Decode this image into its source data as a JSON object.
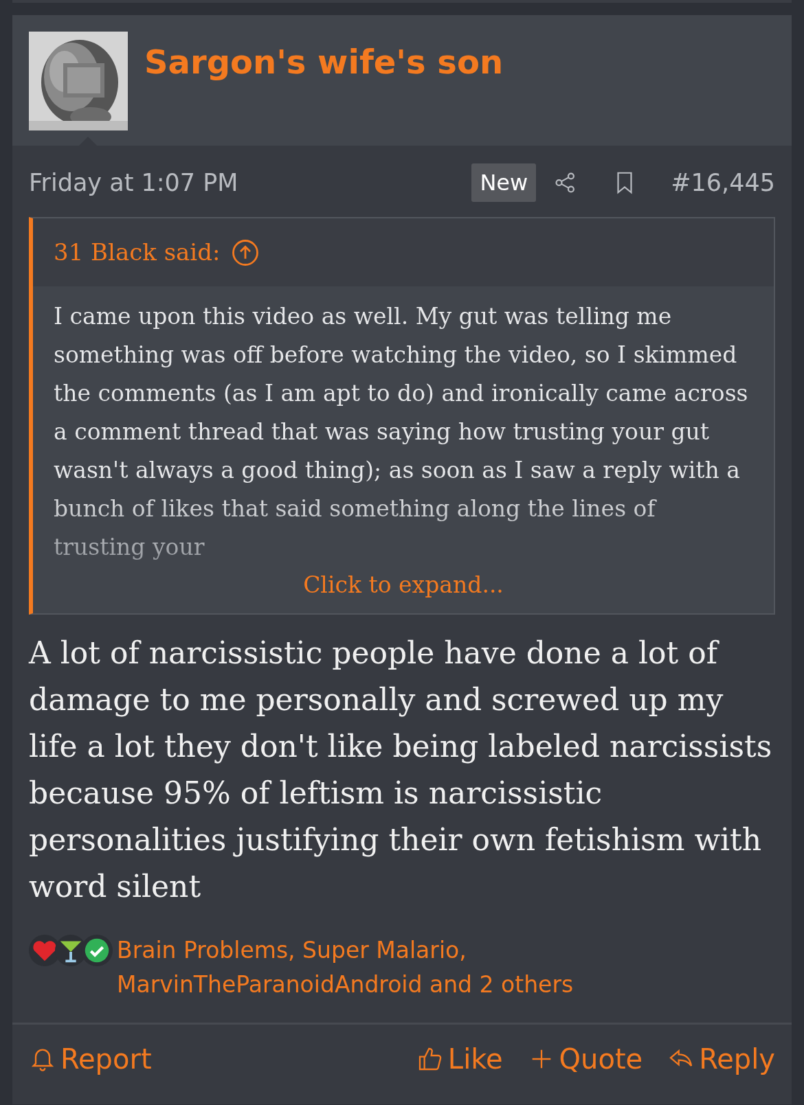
{
  "post": {
    "author": "Sargon's wife's son",
    "date": "Friday at 1:07 PM",
    "badge": "New",
    "number": "#16,445"
  },
  "quote": {
    "attribution": "31 Black said:",
    "text": "I came upon this video as well. My gut was telling me something was off before watching the video, so I skimmed the comments (as I am apt to do) and ironically came across a comment thread that was saying how trusting your gut wasn't always a good thing); as soon as I saw a reply with a bunch of likes that said something along the lines of trusting your",
    "expand": "Click to expand..."
  },
  "message": "A lot of narcissistic people have done a lot of damage to me personally and screwed up my life a lot they don't like being labeled narcissists because 95% of leftism is narcissistic personalities justifying their own fetishism with word silent",
  "reactions": {
    "text": "Brain Problems, Super Malario, MarvinTheParanoidAndroid and 2 others"
  },
  "actions": [
    {
      "kind": "report",
      "label": "Report"
    },
    {
      "kind": "like",
      "label": "Like"
    },
    {
      "kind": "quote",
      "label": "Quote"
    },
    {
      "kind": "reply",
      "label": "Reply"
    }
  ]
}
